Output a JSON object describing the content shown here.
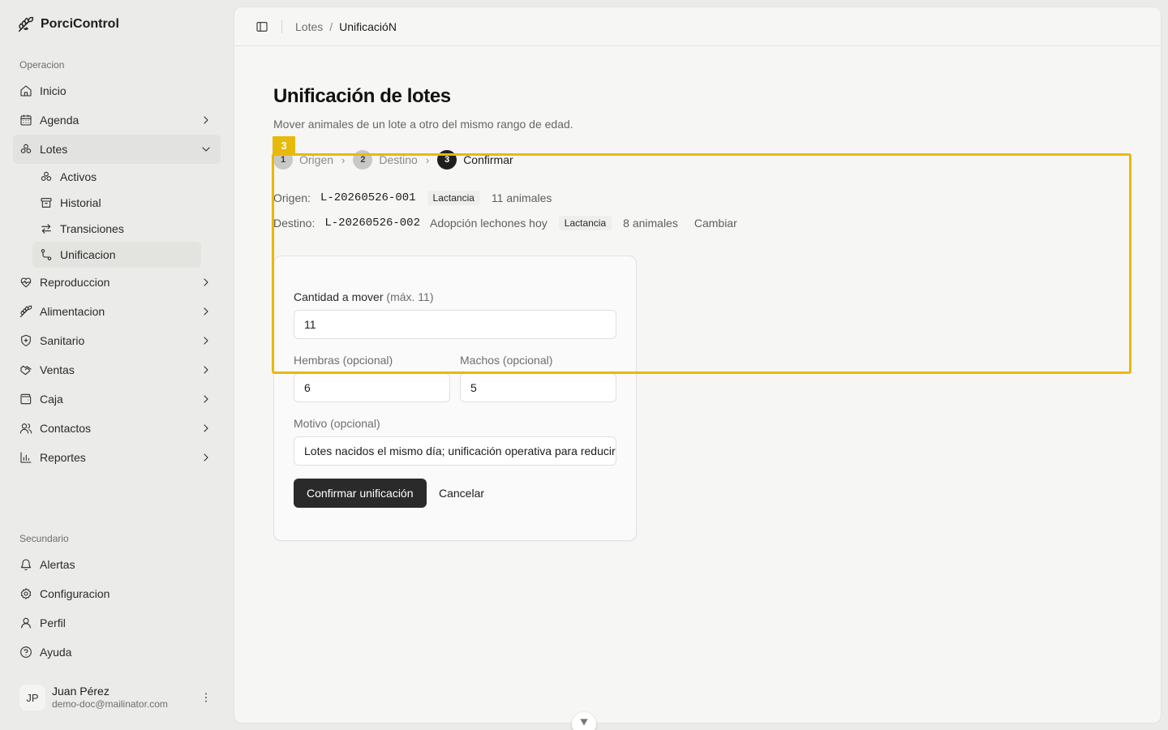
{
  "app": {
    "name": "PorciControl"
  },
  "sidebar": {
    "section_main": "Operacion",
    "section_secondary": "Secundario",
    "items": [
      {
        "label": "Inicio",
        "icon": "home-icon"
      },
      {
        "label": "Agenda",
        "icon": "calendar-icon"
      },
      {
        "label": "Lotes",
        "icon": "lotes-icon"
      },
      {
        "label": "Reproduccion",
        "icon": "heart-pulse-icon"
      },
      {
        "label": "Alimentacion",
        "icon": "wheat-icon"
      },
      {
        "label": "Sanitario",
        "icon": "shield-plus-icon"
      },
      {
        "label": "Ventas",
        "icon": "handshake-icon"
      },
      {
        "label": "Caja",
        "icon": "wallet-icon"
      },
      {
        "label": "Contactos",
        "icon": "users-icon"
      },
      {
        "label": "Reportes",
        "icon": "bar-chart-icon"
      }
    ],
    "lotes_sub": [
      {
        "label": "Activos",
        "icon": "lotes-icon"
      },
      {
        "label": "Historial",
        "icon": "archive-icon"
      },
      {
        "label": "Transiciones",
        "icon": "arrows-exchange-icon"
      },
      {
        "label": "Unificacion",
        "icon": "route-icon"
      }
    ],
    "secondary_items": [
      {
        "label": "Alertas",
        "icon": "bell-icon"
      },
      {
        "label": "Configuracion",
        "icon": "gear-icon"
      },
      {
        "label": "Perfil",
        "icon": "user-icon"
      },
      {
        "label": "Ayuda",
        "icon": "help-circle-icon"
      }
    ],
    "user": {
      "initials": "JP",
      "name": "Juan Pérez",
      "email": "demo-doc@mailinator.com"
    }
  },
  "topbar": {
    "breadcrumb": [
      "Lotes",
      "UnificacióN"
    ],
    "separator": "/"
  },
  "page": {
    "title": "Unificación de lotes",
    "subtitle": "Mover animales de un lote a otro del mismo rango de edad."
  },
  "stepper": {
    "steps": [
      {
        "num": "1",
        "label": "Origen"
      },
      {
        "num": "2",
        "label": "Destino"
      },
      {
        "num": "3",
        "label": "Confirmar"
      }
    ],
    "separator": "›",
    "active_step": 3
  },
  "summary": {
    "origin": {
      "label": "Origen:",
      "code": "L-20260526-001",
      "stage": "Lactancia",
      "count": "11 animales"
    },
    "destination": {
      "label": "Destino:",
      "code": "L-20260526-002",
      "name": "Adopción lechones hoy",
      "stage": "Lactancia",
      "count": "8 animales",
      "change_label": "Cambiar"
    }
  },
  "form": {
    "quantity_label": "Cantidad a mover",
    "quantity_hint": "(máx. 11)",
    "quantity_value": "11",
    "females_label": "Hembras (opcional)",
    "females_value": "6",
    "males_label": "Machos (opcional)",
    "males_value": "5",
    "reason_label": "Motivo (opcional)",
    "reason_value": "Lotes nacidos el mismo día; unificación operativa para reducir corrales",
    "confirm_label": "Confirmar unificación",
    "cancel_label": "Cancelar"
  },
  "annotation": {
    "badge": "3",
    "color": "#e7b90b"
  }
}
